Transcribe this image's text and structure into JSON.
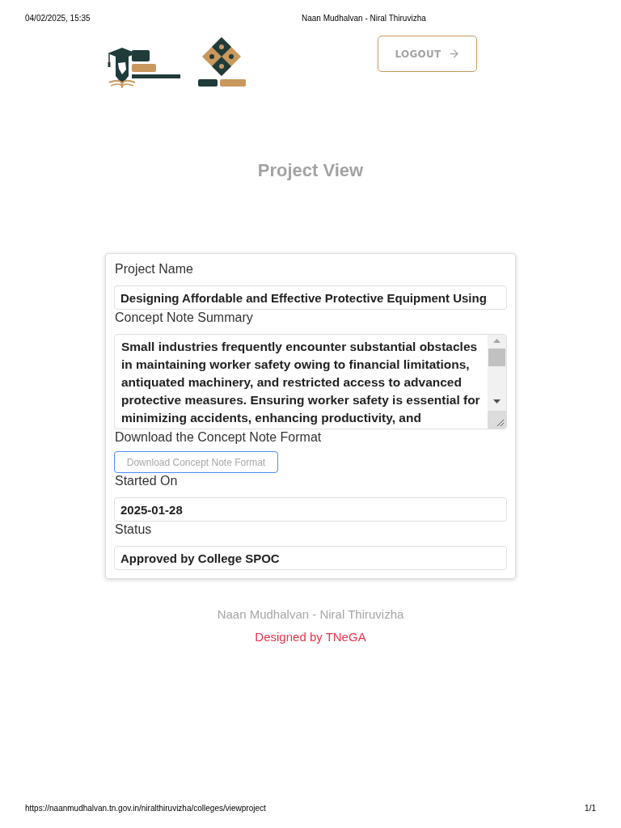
{
  "print_header": {
    "date": "04/02/2025, 15:35",
    "title": "Naan Mudhalvan - Niral Thiruvizha"
  },
  "header": {
    "logout_button": "LOGOUT"
  },
  "page_title": "Project View",
  "form": {
    "fields": [
      {
        "kind": "text",
        "label": "Project Name",
        "value": "Designing Affordable and Effective Protective Equipment Using"
      },
      {
        "kind": "textarea",
        "label": "Concept Note Summary",
        "lines": [
          "Small industries frequently encounter substantial obstacles",
          "in maintaining worker safety owing to financial limitations,",
          "antiquated machinery, and restricted access to advanced",
          "protective measures. Ensuring worker safety is essential for",
          "minimizing accidents, enhancing productivity, and"
        ]
      },
      {
        "kind": "button",
        "label": "Download the Concept Note Format",
        "button": "Download Concept Note Format"
      },
      {
        "kind": "text",
        "label": "Started On",
        "value": "2025-01-28"
      },
      {
        "kind": "text",
        "label": "Status",
        "value": "Approved by College SPOC"
      }
    ]
  },
  "footer": {
    "site": "Naan Mudhalvan - Niral Thiruvizha",
    "credit": "Designed by TNeGA"
  },
  "print_footer": {
    "url": "https://naanmudhalvan.tn.gov.in/niralthiruvizha/colleges/viewproject",
    "page": "1/1"
  }
}
